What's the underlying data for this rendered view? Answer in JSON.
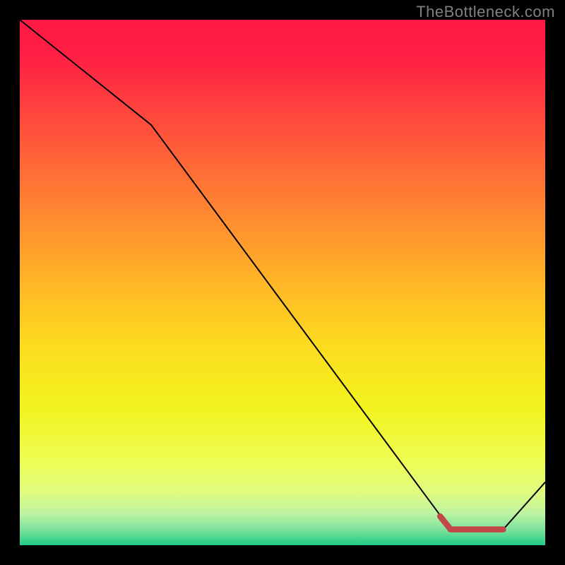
{
  "watermark": "TheBottleneck.com",
  "chart_data": {
    "type": "line",
    "title": "",
    "xlabel": "",
    "ylabel": "",
    "xlim": [
      0,
      100
    ],
    "ylim": [
      0,
      100
    ],
    "grid": false,
    "series": [
      {
        "name": "main-line",
        "color": "#000000",
        "stroke_width": 2,
        "x": [
          0,
          25,
          82,
          92,
          100
        ],
        "values": [
          100,
          80,
          3,
          3,
          12
        ]
      },
      {
        "name": "highlight-segment",
        "color": "#C24848",
        "stroke_width": 8.5,
        "linecap": "round",
        "x": [
          80,
          82,
          92
        ],
        "values": [
          5.5,
          3,
          3
        ]
      }
    ],
    "background_gradient": {
      "stops": [
        {
          "offset": 0.0,
          "color": "#FF1844"
        },
        {
          "offset": 0.07,
          "color": "#FF1F44"
        },
        {
          "offset": 0.16,
          "color": "#FF3F3F"
        },
        {
          "offset": 0.27,
          "color": "#FF6638"
        },
        {
          "offset": 0.38,
          "color": "#FF8C30"
        },
        {
          "offset": 0.5,
          "color": "#FFB626"
        },
        {
          "offset": 0.62,
          "color": "#FCDB1F"
        },
        {
          "offset": 0.74,
          "color": "#F2F41E"
        },
        {
          "offset": 0.84,
          "color": "#EEFD53"
        },
        {
          "offset": 0.9,
          "color": "#E0FB80"
        },
        {
          "offset": 0.94,
          "color": "#BCF3A2"
        },
        {
          "offset": 0.97,
          "color": "#7EE29E"
        },
        {
          "offset": 1.0,
          "color": "#20CB83"
        }
      ]
    }
  }
}
